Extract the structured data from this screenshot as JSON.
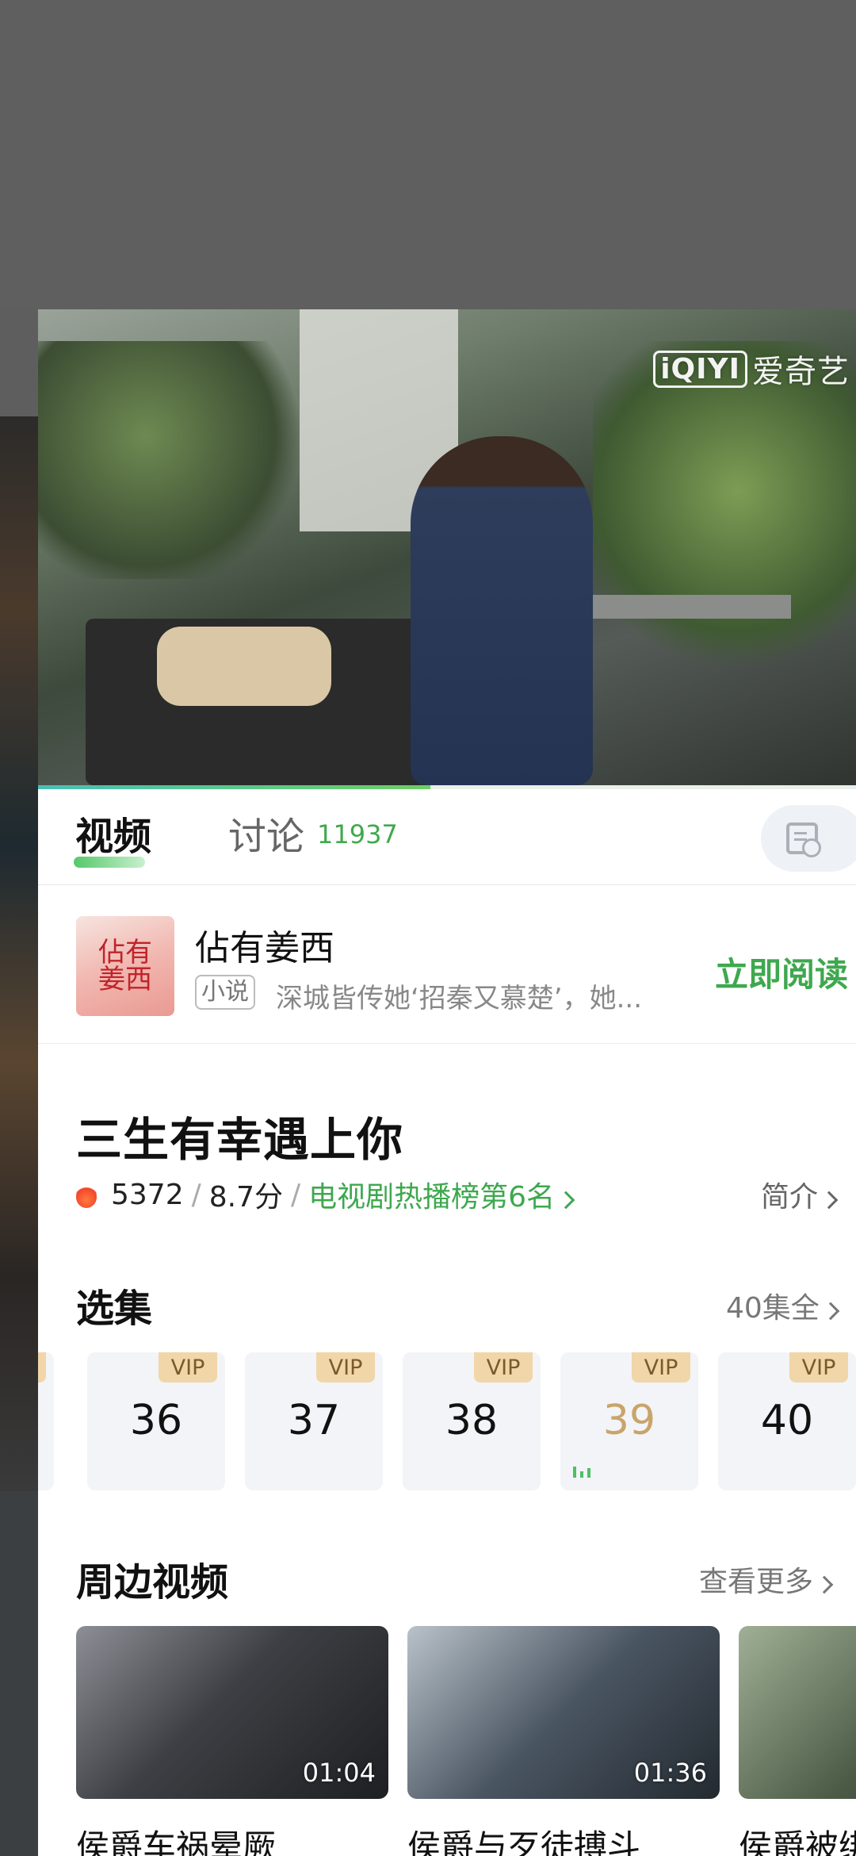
{
  "player": {
    "logo_box": "iQIYI",
    "logo_text": "爱奇艺",
    "progress": 0.48
  },
  "tabs": {
    "video": "视频",
    "discuss": "讨论",
    "discuss_count": "11937"
  },
  "novel": {
    "cover_text_1": "佔有",
    "cover_text_2": "姜西",
    "title": "佔有姜西",
    "tag": "小说",
    "desc": "深城皆传她‘招秦又慕楚’，她...",
    "read_label": "立即阅读"
  },
  "show": {
    "title": "三生有幸遇上你",
    "heat": "5372",
    "score": "8.7分",
    "rank": "电视剧热播榜第6名",
    "intro_label": "简介"
  },
  "episodes": {
    "section_title": "选集",
    "total_label": "40集全",
    "partial_badge": "P",
    "items": [
      {
        "num": "36",
        "badge": "VIP"
      },
      {
        "num": "37",
        "badge": "VIP"
      },
      {
        "num": "38",
        "badge": "VIP"
      },
      {
        "num": "39",
        "badge": "VIP",
        "playing": true
      },
      {
        "num": "40",
        "badge": "VIP"
      }
    ]
  },
  "related": {
    "section_title": "周边视频",
    "more_label": "查看更多",
    "items": [
      {
        "title": "侯爵车祸晕厥",
        "duration": "01:04"
      },
      {
        "title": "侯爵与歹徒搏斗",
        "duration": "01:36"
      },
      {
        "title": "侯爵被绑",
        "duration": ""
      }
    ]
  },
  "colors": {
    "accent_green": "#3ea84e",
    "vip_gold": "#f0d6a8",
    "playing_gold": "#c9a46a"
  }
}
